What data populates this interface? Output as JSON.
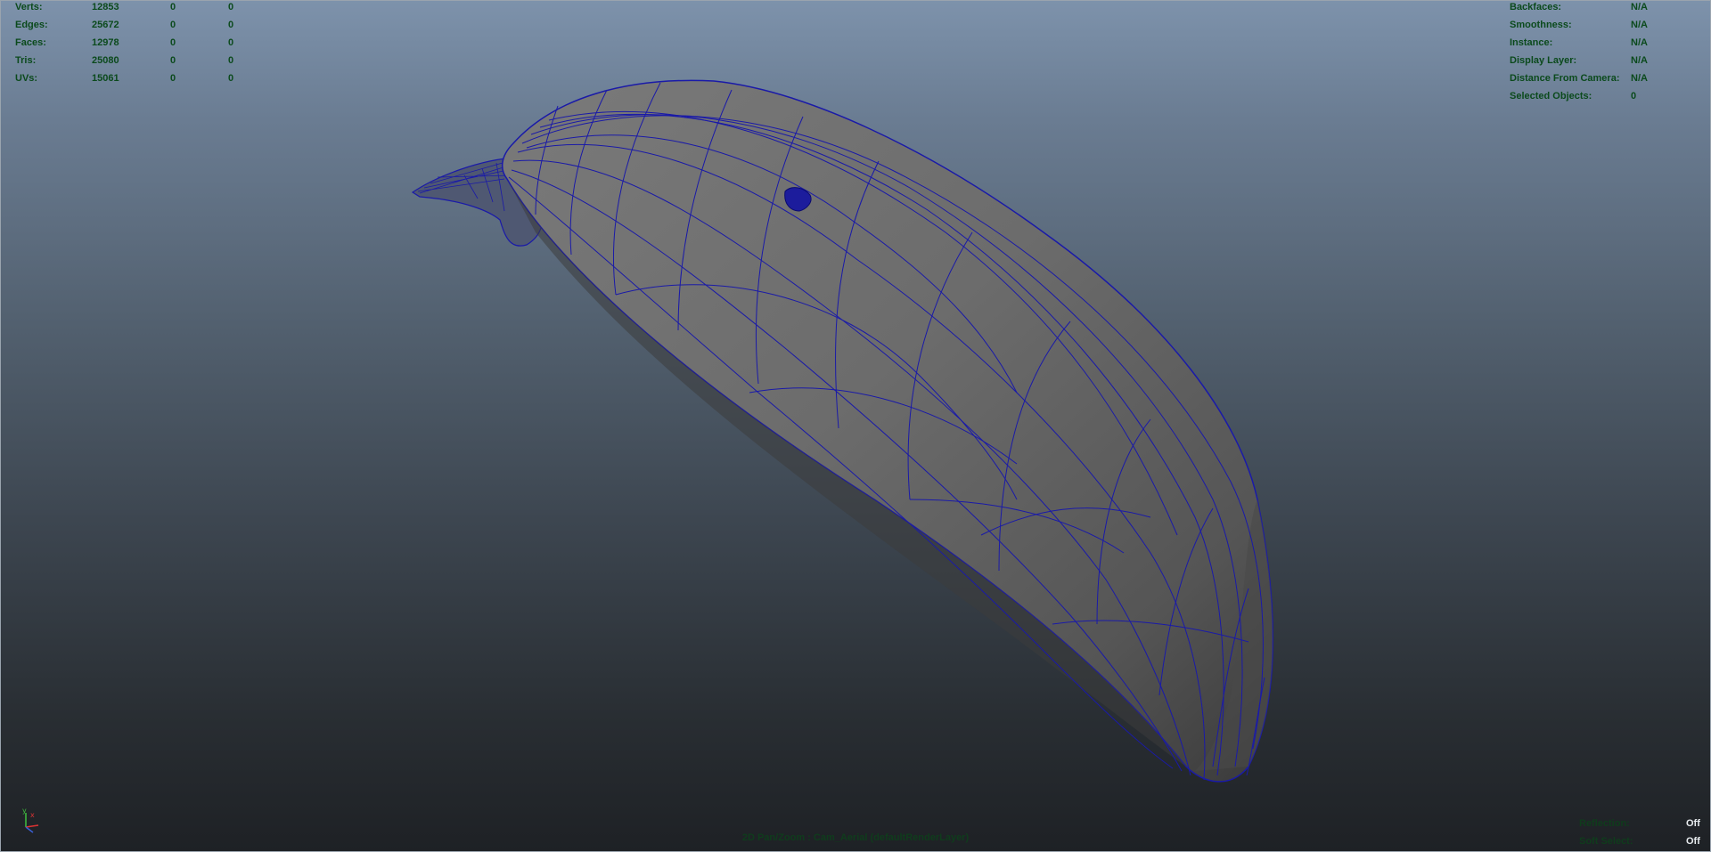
{
  "poly_count": {
    "rows": [
      {
        "label": "Verts:",
        "v1": "12853",
        "v2": "0",
        "v3": "0"
      },
      {
        "label": "Edges:",
        "v1": "25672",
        "v2": "0",
        "v3": "0"
      },
      {
        "label": "Faces:",
        "v1": "12978",
        "v2": "0",
        "v3": "0"
      },
      {
        "label": "Tris:",
        "v1": "25080",
        "v2": "0",
        "v3": "0"
      },
      {
        "label": "UVs:",
        "v1": "15061",
        "v2": "0",
        "v3": "0"
      }
    ]
  },
  "object_details": {
    "rows": [
      {
        "label": "Backfaces:",
        "value": "N/A"
      },
      {
        "label": "Smoothness:",
        "value": "N/A"
      },
      {
        "label": "Instance:",
        "value": "N/A"
      },
      {
        "label": "Display Layer:",
        "value": "N/A"
      },
      {
        "label": "Distance From Camera:",
        "value": "N/A"
      },
      {
        "label": "Selected Objects:",
        "value": "0"
      }
    ]
  },
  "viewport_status": {
    "reflection_label": "Reflection:",
    "reflection_value": "Off",
    "soft_select_label": "Soft Select:",
    "soft_select_value": "Off"
  },
  "camera_label": "2D Pan/Zoom : Cam_Aerial (defaultRenderLayer)",
  "axis": {
    "y": "y",
    "x": "x"
  },
  "colors": {
    "wireframe": "#1a1aa8",
    "hud_text": "#0b4a1c",
    "surface": "#6e6e6e"
  }
}
